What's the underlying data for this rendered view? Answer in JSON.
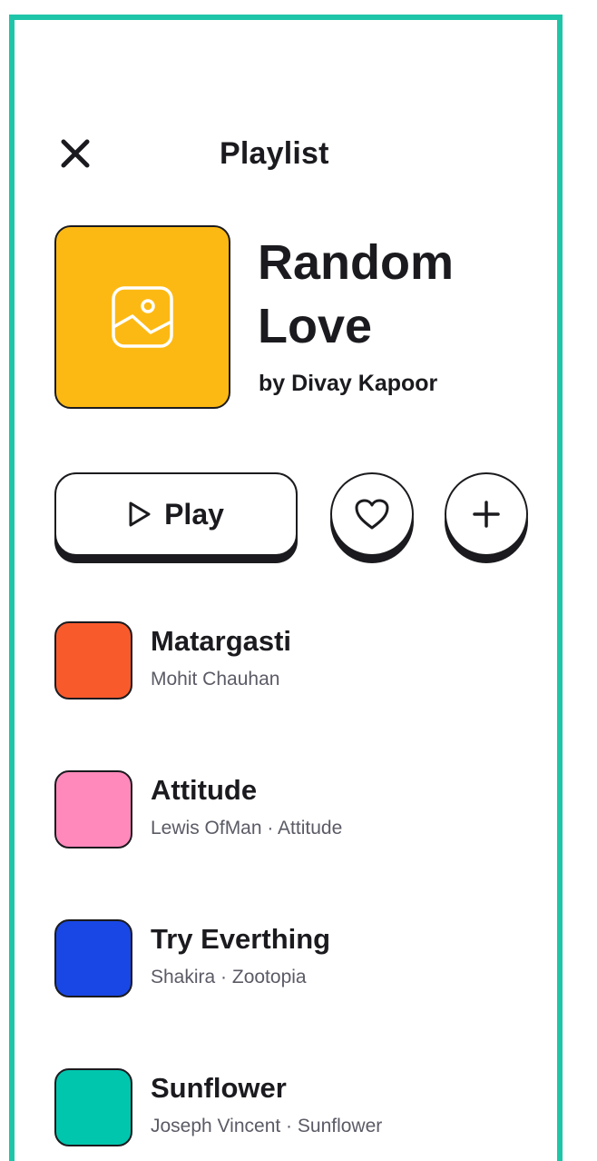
{
  "header": {
    "title": "Playlist"
  },
  "playlist": {
    "title_line1": "Random",
    "title_line2": "Love",
    "author": "by Divay Kapoor",
    "cover_color": "#fdb913"
  },
  "actions": {
    "play_label": "Play"
  },
  "songs": [
    {
      "title": "Matargasti",
      "subtitle": "Mohit Chauhan",
      "color": "#f95a2c"
    },
    {
      "title": "Attitude",
      "subtitle": "Lewis OfMan · Attitude",
      "color": "#ff89bb"
    },
    {
      "title": "Try Everthing",
      "subtitle": "Shakira · Zootopia",
      "color": "#1947e5"
    },
    {
      "title": "Sunflower",
      "subtitle": "Joseph Vincent · Sunflower",
      "color": "#00c6ae"
    }
  ],
  "theme": {
    "frame_color": "#1fc5a8",
    "ink": "#1b1b1f"
  }
}
